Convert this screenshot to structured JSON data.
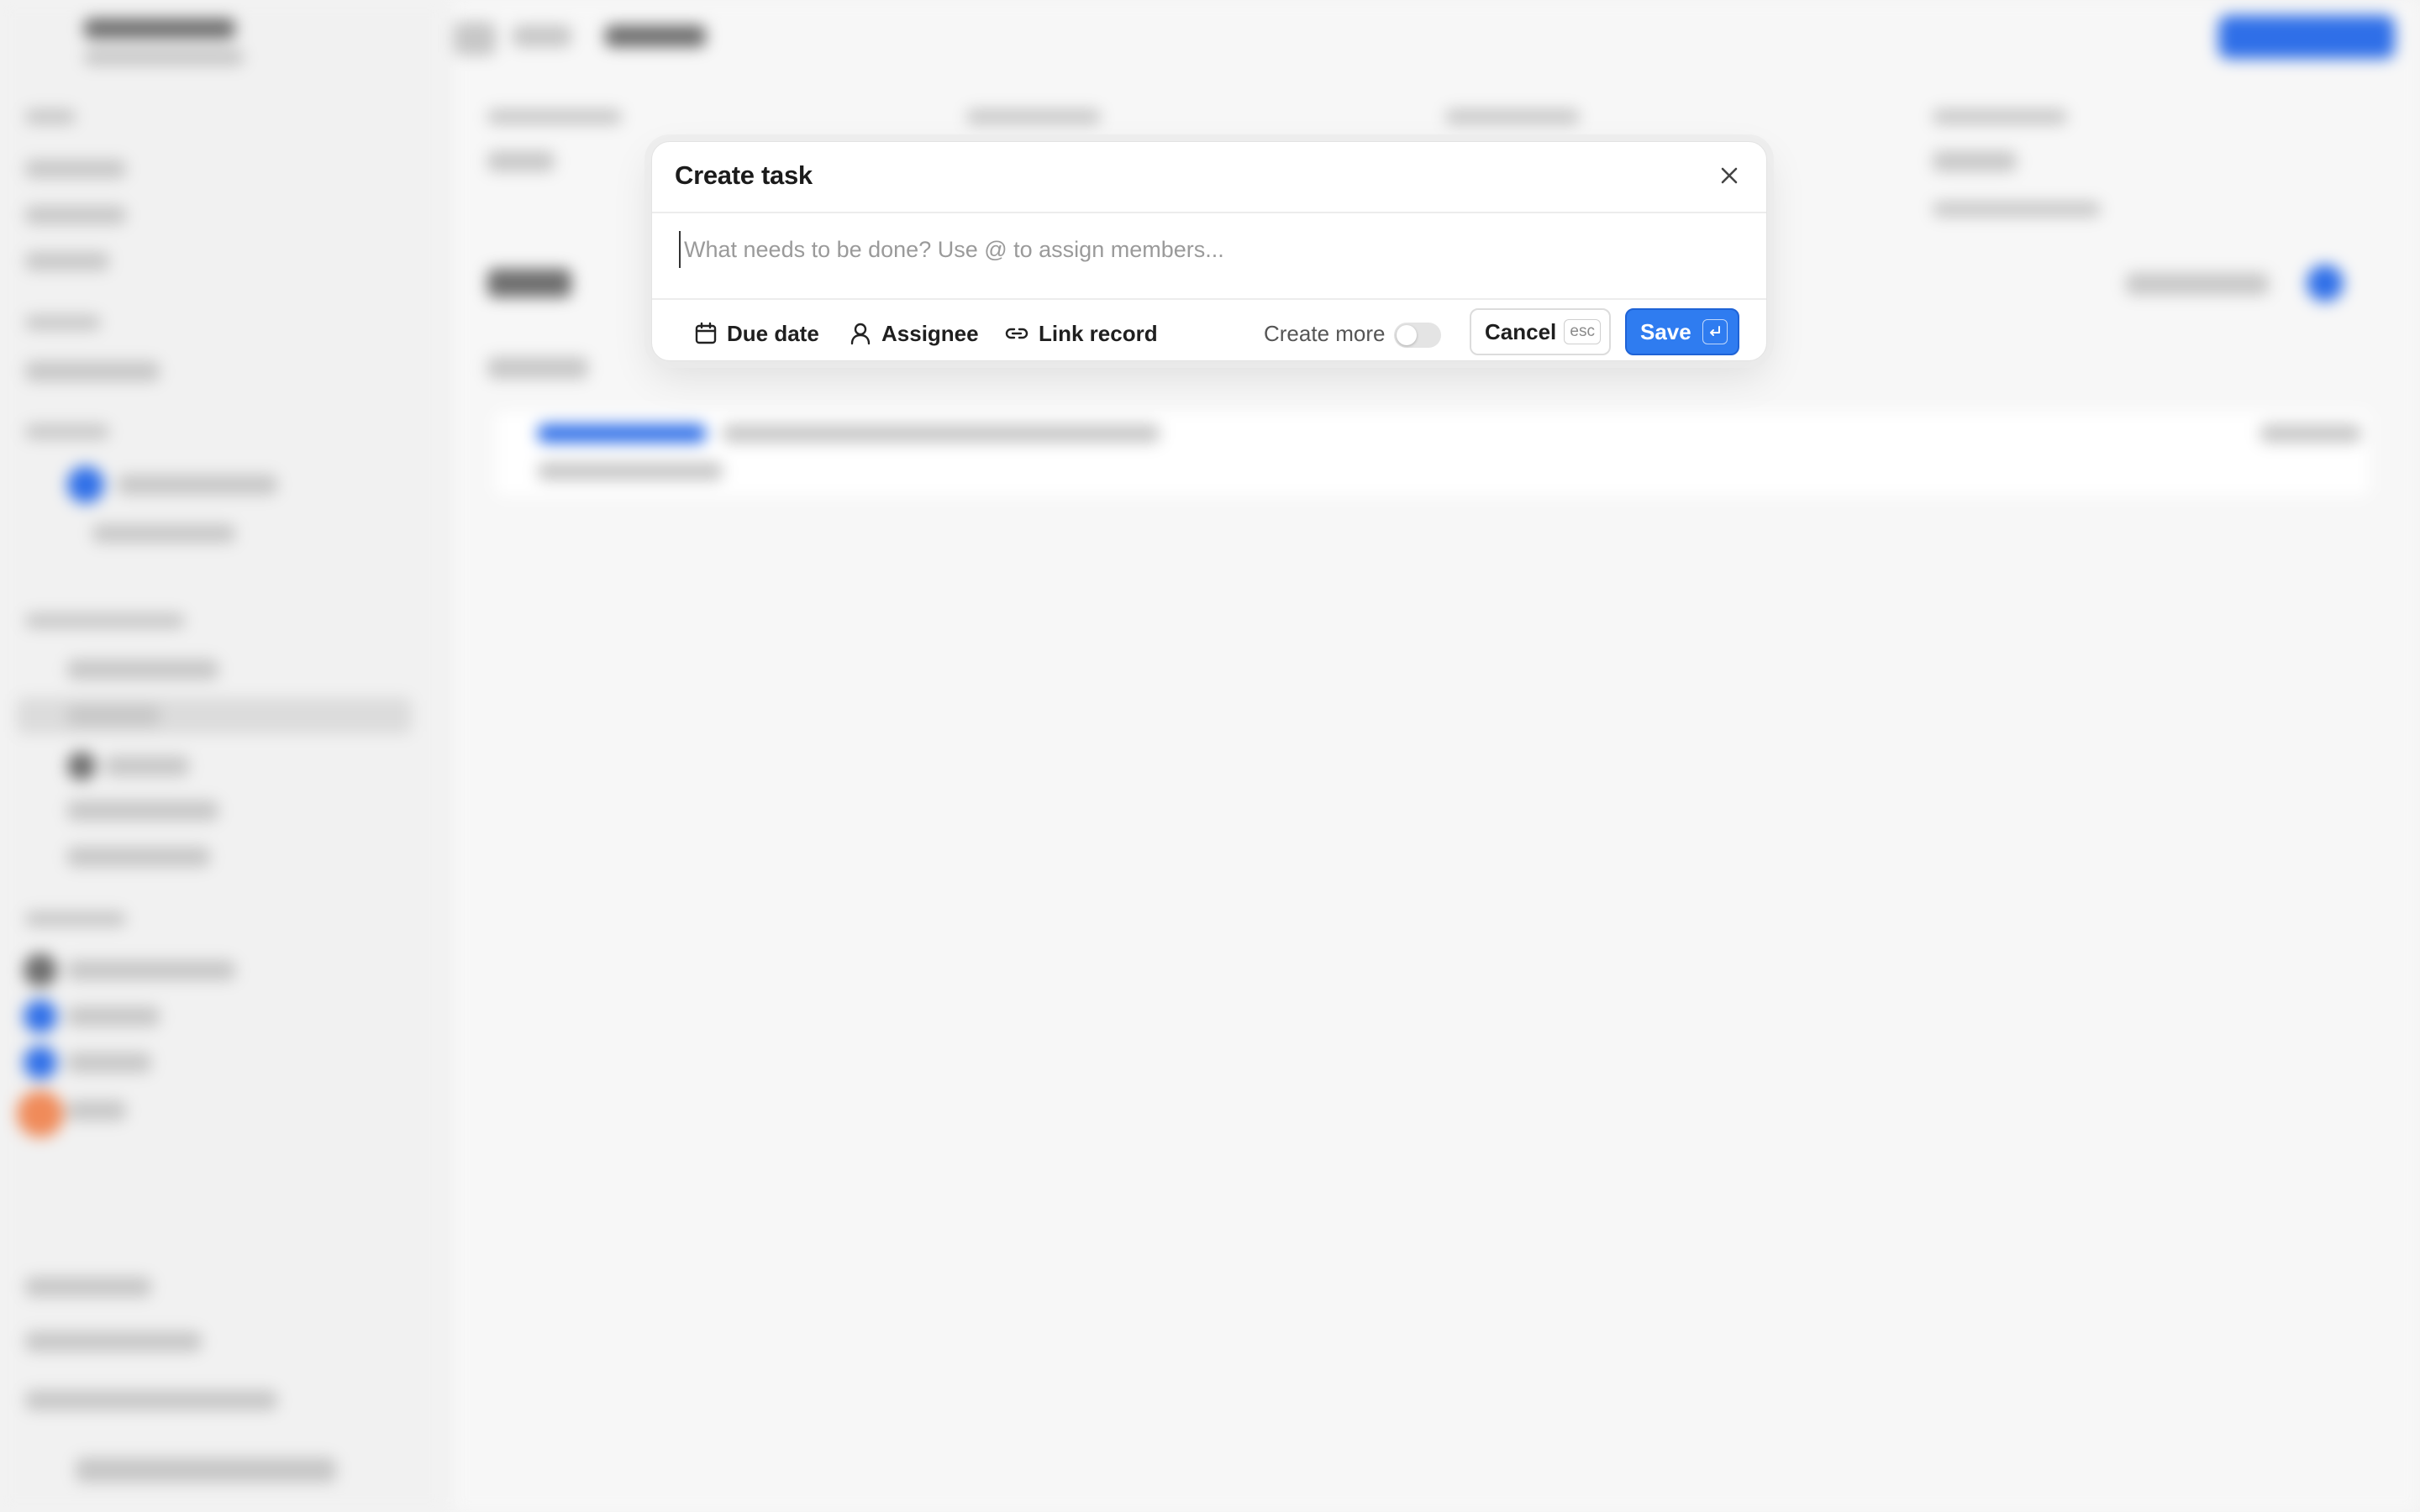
{
  "dialog": {
    "title": "Create task",
    "input_placeholder": "What needs to be done? Use @ to assign members...",
    "input_value": "",
    "actions": {
      "due_date_label": "Due date",
      "assignee_label": "Assignee",
      "link_record_label": "Link record"
    },
    "create_more_label": "Create more",
    "create_more_enabled": false,
    "cancel_label": "Cancel",
    "cancel_shortcut": "esc",
    "save_label": "Save",
    "icons": {
      "close": "close-icon",
      "due_date": "calendar-icon",
      "assignee": "user-icon",
      "link_record": "link-icon",
      "save_shortcut": "enter-key-icon"
    },
    "colors": {
      "save_background": "#2f7cf0",
      "title_text": "#1b1b1b",
      "placeholder_text": "#9a9a9a"
    }
  }
}
